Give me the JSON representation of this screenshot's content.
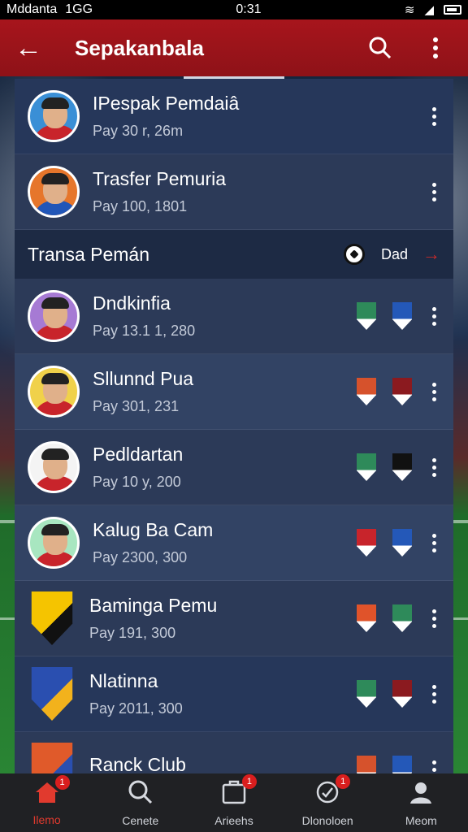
{
  "status": {
    "carrier": "Mddanta",
    "network": "1GG",
    "time": "0:31"
  },
  "app": {
    "title": "Sepakanbala"
  },
  "top_rows": [
    {
      "name": "IPespak Pemdaiâ",
      "pay": "Pay 30 r, 26m",
      "shirt": "#c8242b",
      "bg": "#3a8fd6"
    },
    {
      "name": "Trasfer Pemuria",
      "pay": "Pay 100, 1801",
      "shirt": "#2156b8",
      "bg": "#e6762b"
    }
  ],
  "section": {
    "title": "Transa Pemán",
    "more": "Dad"
  },
  "rows": [
    {
      "name": "Dndkinfia",
      "pay": "Pay 13.1 1, 280",
      "type": "avatar",
      "bg": "#a67ad4",
      "shirt": "#c8242b",
      "b1": "#2e8a5a",
      "b2": "#2458b8",
      "tone": "mid"
    },
    {
      "name": "Sllunnd Pua",
      "pay": "Pay 301, 231",
      "type": "avatar",
      "bg": "#f0d14a",
      "shirt": "#c8242b",
      "b1": "#d6522c",
      "b2": "#8b1a1f",
      "tone": "alt"
    },
    {
      "name": "Pedldartan",
      "pay": "Pay 10 y, 200",
      "type": "avatar",
      "bg": "#f4f4f4",
      "shirt": "#c8242b",
      "b1": "#2e8a5a",
      "b2": "#111111",
      "tone": "mid"
    },
    {
      "name": "Kalug Ba Cam",
      "pay": "Pay 2300, 300",
      "type": "avatar",
      "bg": "#a8e6c0",
      "shirt": "#c8242b",
      "b1": "#c8242b",
      "b2": "#2458b8",
      "tone": "alt"
    },
    {
      "name": "Baminga Pemu",
      "pay": "Pay 191, 300",
      "type": "crest",
      "bg": "#f5c400",
      "shirt": "#111111",
      "b1": "#e0532a",
      "b2": "#2e8a5a",
      "tone": "mid"
    },
    {
      "name": "Nlatinna",
      "pay": "Pay 2011, 300",
      "type": "crest",
      "bg": "#2a4fb0",
      "shirt": "#f2b21c",
      "b1": "#2e8a5a",
      "b2": "#8b1a1f",
      "tone": "dark"
    },
    {
      "name": "Ranck Club",
      "pay": "",
      "type": "crest",
      "bg": "#e05a2a",
      "shirt": "#2a4fb0",
      "b1": "#d6522c",
      "b2": "#2458b8",
      "tone": "mid"
    }
  ],
  "nav": [
    {
      "label": "Ilemo",
      "badge": "1",
      "active": true
    },
    {
      "label": "Cenete",
      "badge": "",
      "active": false
    },
    {
      "label": "Arieehs",
      "badge": "1",
      "active": false
    },
    {
      "label": "Dlonoloen",
      "badge": "1",
      "active": false
    },
    {
      "label": "Meom",
      "badge": "",
      "active": false
    }
  ]
}
